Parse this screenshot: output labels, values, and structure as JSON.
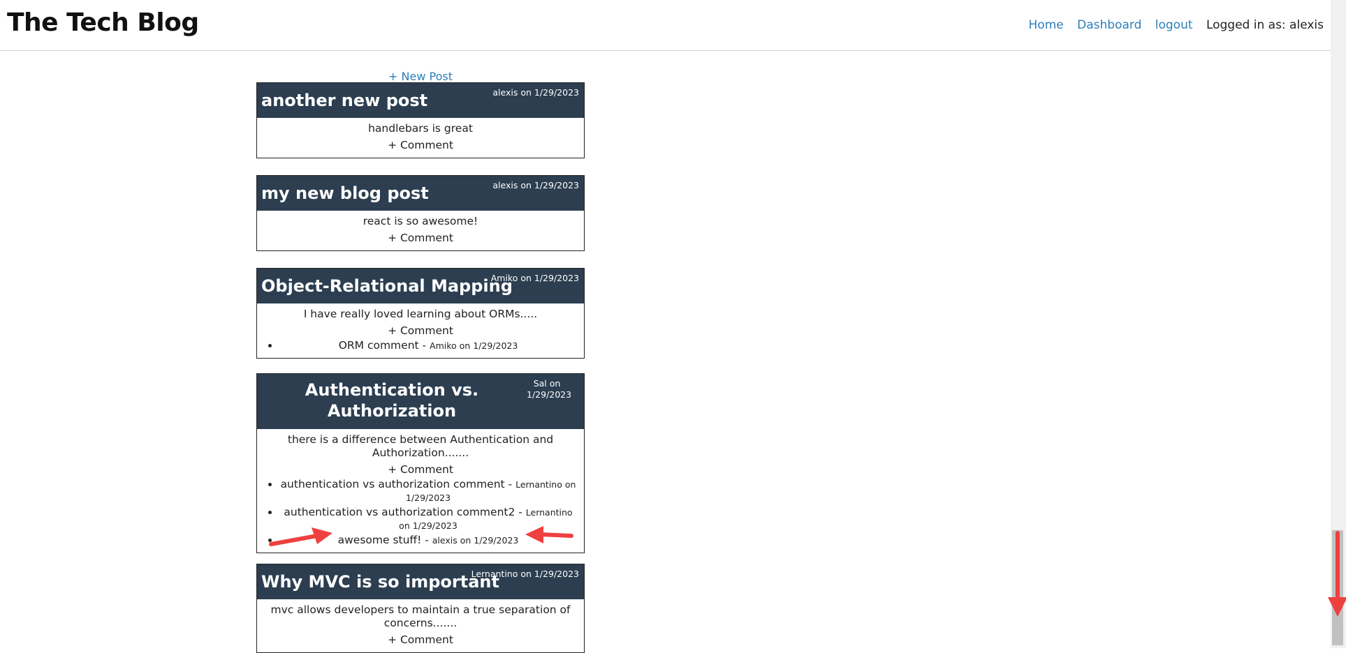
{
  "header": {
    "title": "The Tech Blog",
    "nav": {
      "home": "Home",
      "dashboard": "Dashboard",
      "logout": "logout",
      "logged_in": "Logged in as: alexis"
    }
  },
  "main": {
    "new_post_label": "+ New Post",
    "comment_label": "+ Comment",
    "posts": [
      {
        "title": "another new post",
        "meta": "alexis on 1/29/2023",
        "content": "handlebars is great",
        "comments": []
      },
      {
        "title": "my new blog post",
        "meta": "alexis on 1/29/2023",
        "content": "react is so awesome!",
        "comments": []
      },
      {
        "title": "Object-Relational Mapping",
        "meta": "Amiko on 1/29/2023",
        "content": "I have really loved learning about ORMs.....",
        "comments": [
          {
            "text": "ORM comment - ",
            "meta": "Amiko on 1/29/2023"
          }
        ]
      },
      {
        "title": "Authentication vs. Authorization",
        "meta": "Sal on 1/29/2023",
        "content": "there is a difference between Authentication and Authorization.......",
        "comments": [
          {
            "text": "authentication vs authorization comment - ",
            "meta": "Lernantino on 1/29/2023"
          },
          {
            "text": "authentication vs authorization comment2 - ",
            "meta": "Lernantino on 1/29/2023"
          },
          {
            "text": "awesome stuff! - ",
            "meta": "alexis on 1/29/2023"
          }
        ]
      },
      {
        "title": "Why MVC is so important",
        "meta": "Lernantino on 1/29/2023",
        "content": "mvc allows developers to maintain a true separation of concerns.......",
        "comments": []
      }
    ]
  },
  "colors": {
    "post_header_bg": "#2c3e50",
    "link": "#2c7fb8",
    "annotation_arrow": "#ef4040"
  }
}
